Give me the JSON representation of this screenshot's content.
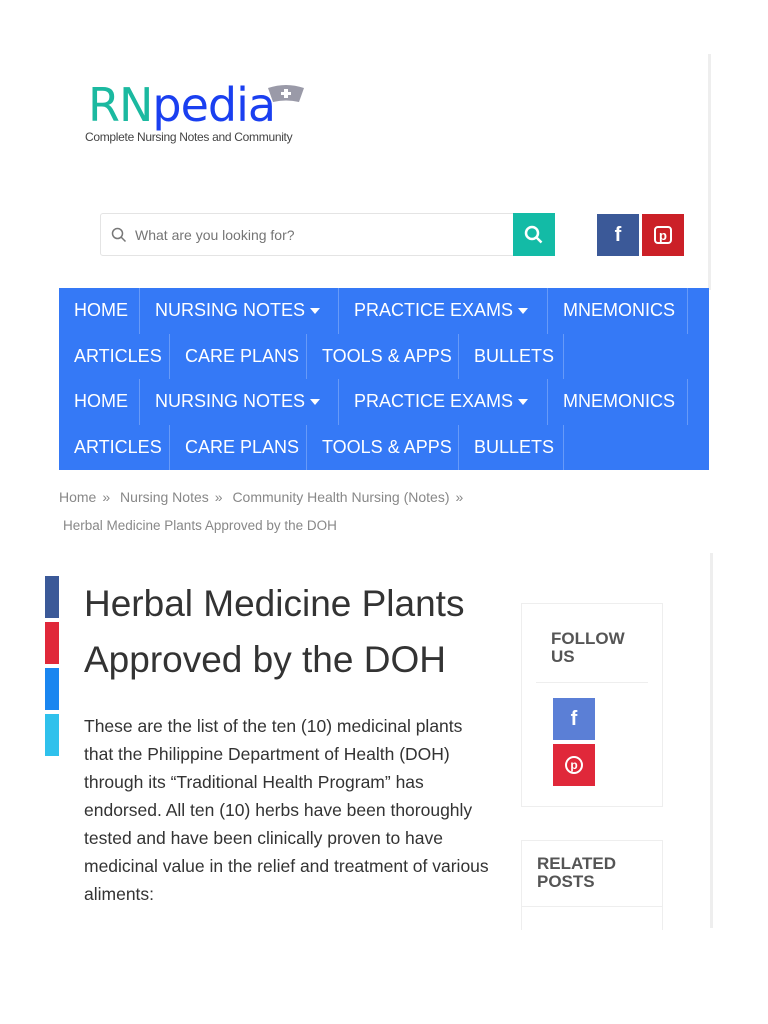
{
  "logo": {
    "rn": "RN",
    "pedia": "pedia",
    "tagline": "Complete Nursing Notes and Community"
  },
  "search": {
    "placeholder": "What are you looking for?"
  },
  "nav": {
    "rows": [
      [
        "HOME",
        "NURSING NOTES",
        "PRACTICE EXAMS",
        "MNEMONICS"
      ],
      [
        "ARTICLES",
        "CARE PLANS",
        "TOOLS & APPS",
        "BULLETS"
      ],
      [
        "HOME",
        "NURSING NOTES",
        "PRACTICE EXAMS",
        "MNEMONICS"
      ],
      [
        "ARTICLES",
        "CARE PLANS",
        "TOOLS & APPS",
        "BULLETS"
      ]
    ]
  },
  "breadcrumb": {
    "home": "Home",
    "nursing_notes": "Nursing Notes",
    "community": "Community Health Nursing (Notes)",
    "current": "Herbal Medicine Plants Approved by the DOH"
  },
  "article": {
    "title": "Herbal Medicine Plants Approved by the DOH",
    "intro": "These are the list of the ten (10) medicinal plants that the Philippine Department of Health (DOH) through its “Traditional Health Program” has endorsed. All ten (10) herbs have been thoroughly tested and have been clinically proven to have medicinal value in the relief and treatment of various aliments:"
  },
  "sidebar": {
    "follow_title": "FOLLOW US",
    "related_title": "RELATED POSTS"
  },
  "colors": {
    "nav": "#3579f6",
    "teal": "#13bba6",
    "facebook": "#3b5998",
    "pinterest": "#cb2027"
  }
}
